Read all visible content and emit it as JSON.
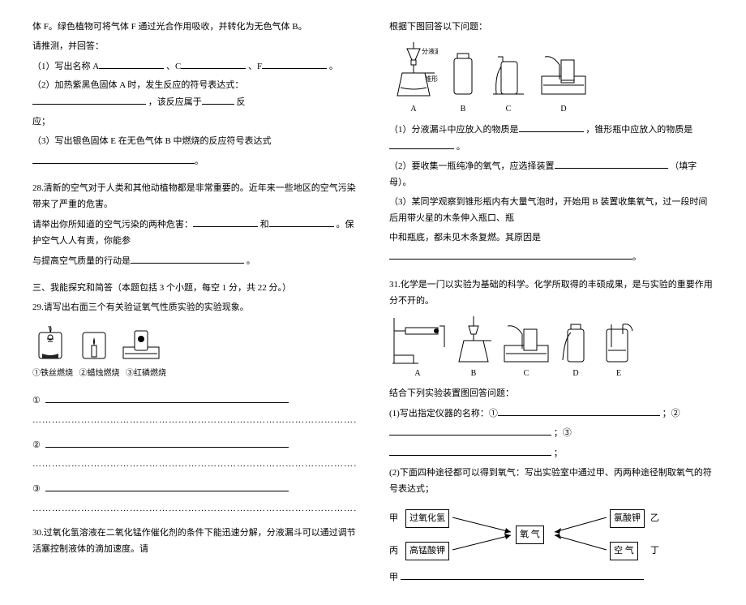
{
  "left": {
    "p1": "体 F。绿色植物可将气体 F 通过光合作用吸收，并转化为无色气体 B。",
    "p2": "请推测，并回答：",
    "q1a": "（1）写出名称 A",
    "q1b": "、C",
    "q1c": "、F",
    "q1d": "。",
    "q2a": "（2）加热紫黑色固体 A 时，发生反应的符号表达式：",
    "q2b": "，该反应属于",
    "q2c": "反",
    "q2c2": "应；",
    "q3a": "（3）写出银色固体 E 在无色气体 B 中燃烧的反应符号表达式",
    "q3b": "。",
    "p28a": "28.清新的空气对于人类和其他动植物都是非常重要的。近年来一些地区的空气污染带来了严重的危害。",
    "p28b": "请举出你所知道的空气污染的两种危害：",
    "p28c": "和",
    "p28d": "。保护空气人人有责，你能参",
    "p28e": "与提高空气质量的行动是",
    "p28f": "。",
    "sec3": "三、我能探究和简答（本题包括 3 个小题，每空 1 分，共 22 分。）",
    "p29": "29.请写出右面三个有关验证氧气性质实验的实验现象。",
    "cap1": "①铁丝燃烧",
    "cap2": "②蜡烛燃烧",
    "cap3": "③红磷燃烧",
    "n1": "①",
    "n2": "②",
    "n3": "③",
    "p30": "30.过氧化氢溶液在二氧化锰作催化剂的条件下能迅速分解，分液漏斗可以通过调节活塞控制液体的滴加速度。请"
  },
  "right": {
    "p1": "根据下图回答以下问题：",
    "labFunnel": "分液漏斗",
    "labFlask": "锥形瓶",
    "labA": "A",
    "labB": "B",
    "labC": "C",
    "labD": "D",
    "labE": "E",
    "q1a": "（1）分液漏斗中应放入的物质是",
    "q1b": "，锥形瓶中应放入的物质是",
    "q1c": "。",
    "q2a": "（2）要收集一瓶纯净的氧气，应选择装置",
    "q2b": "（填字母）。",
    "q3a": "（3）某同学观察到锥形瓶内有大量气泡时，开始用 B 装置收集氧气，过一段时间后用带火星的木条伸入瓶口、瓶",
    "q3b": "中和瓶底，都未见木条复燃。其原因是",
    "p31": "31.化学是一门以实验为基础的科学。化学所取得的丰硕成果，是与实验的重要作用分不开的。",
    "belowQ": "结合下列实验装置图回答问题：",
    "iq1a": "(1)写出指定仪器的名称：①",
    "iq1b": "；②",
    "iq1c": "；③",
    "iq1d": "；",
    "iq2a": "(2)下面四种途径都可以得到氧气：写出实验室中通过甲、丙两种途径制取氧气的符号表达式；",
    "box1": "过氧化氢",
    "box2": "高锰酸钾",
    "box3": "氧 气",
    "box4": "氯酸钾",
    "box5": "空 气",
    "rl1": "甲",
    "rl2": "丙",
    "rl3": "乙",
    "rl4": "丁",
    "lastLabel": "甲"
  }
}
